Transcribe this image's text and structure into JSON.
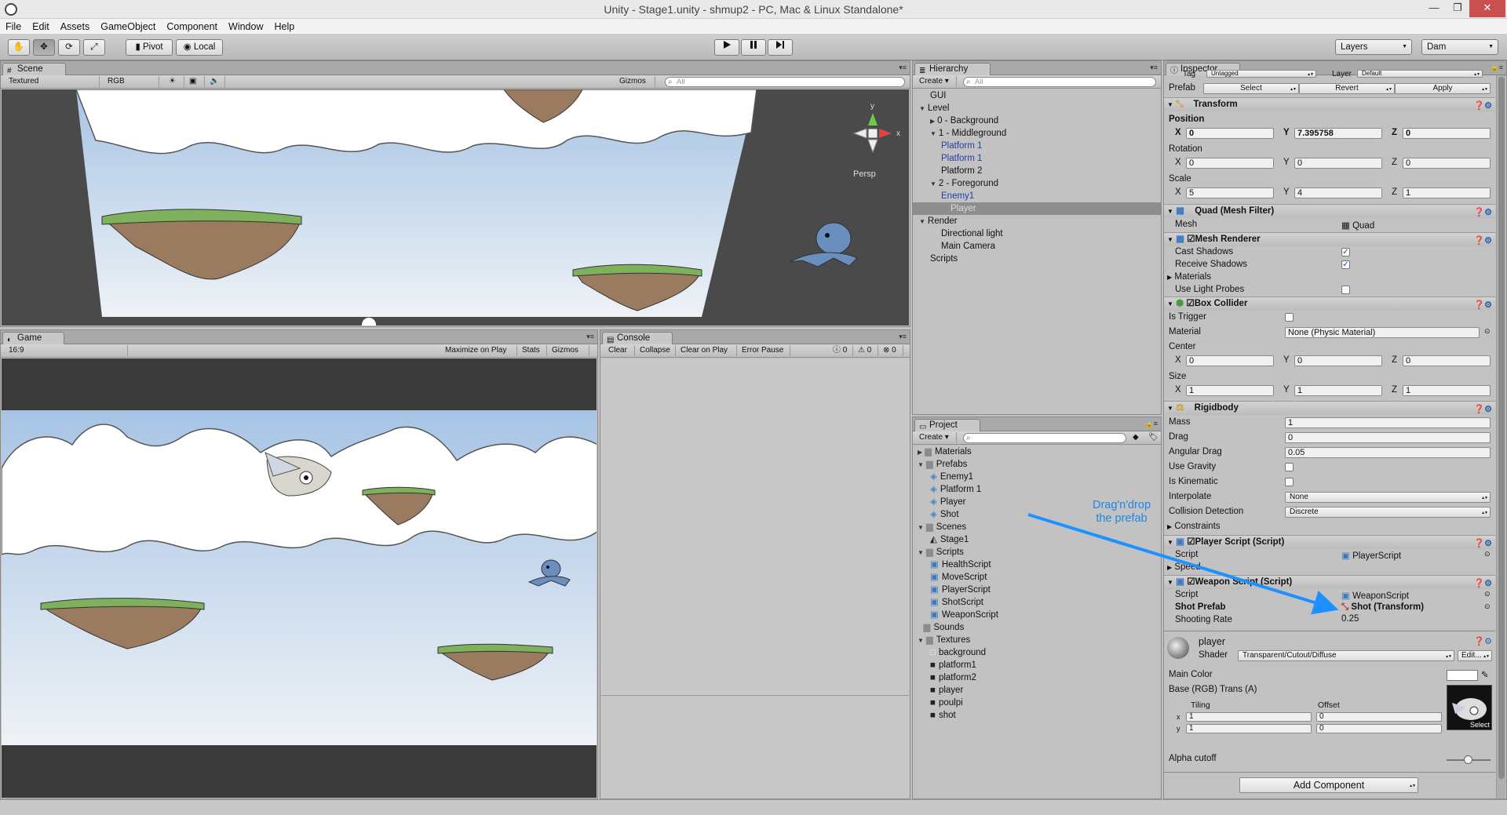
{
  "window": {
    "title": "Unity - Stage1.unity - shmup2 - PC, Mac & Linux Standalone*"
  },
  "menu": [
    "File",
    "Edit",
    "Assets",
    "GameObject",
    "Component",
    "Window",
    "Help"
  ],
  "toolbar": {
    "pivot": "Pivot",
    "local": "Local",
    "layers": "Layers",
    "layout": "Dam"
  },
  "scene": {
    "tab": "Scene",
    "shading": "Textured",
    "mode": "RGB",
    "gizmos": "Gizmos",
    "search_placeholder": "All",
    "persp": "Persp",
    "gizmo_x": "x",
    "gizmo_y": "y"
  },
  "game": {
    "tab": "Game",
    "aspect": "16:9",
    "maximize": "Maximize on Play",
    "stats": "Stats",
    "gizmos": "Gizmos"
  },
  "console": {
    "tab": "Console",
    "clear": "Clear",
    "collapse": "Collapse",
    "clear_on_play": "Clear on Play",
    "error_pause": "Error Pause",
    "count_info": "0",
    "count_warn": "0",
    "count_error": "0"
  },
  "hierarchy": {
    "tab": "Hierarchy",
    "create": "Create",
    "search_placeholder": "All",
    "items": [
      {
        "label": "GUI",
        "indent": 0,
        "arrow": "",
        "style": ""
      },
      {
        "label": "Level",
        "indent": 0,
        "arrow": "down",
        "style": ""
      },
      {
        "label": "0 - Background",
        "indent": 1,
        "arrow": "right",
        "style": ""
      },
      {
        "label": "1 - Middleground",
        "indent": 1,
        "arrow": "down",
        "style": ""
      },
      {
        "label": "Platform 1",
        "indent": 2,
        "arrow": "",
        "style": "blue"
      },
      {
        "label": "Platform 1",
        "indent": 2,
        "arrow": "",
        "style": "blue"
      },
      {
        "label": "Platform 2",
        "indent": 2,
        "arrow": "",
        "style": ""
      },
      {
        "label": "2 - Foregorund",
        "indent": 1,
        "arrow": "down",
        "style": ""
      },
      {
        "label": "Enemy1",
        "indent": 2,
        "arrow": "",
        "style": "blue"
      },
      {
        "label": "Player",
        "indent": 2,
        "arrow": "",
        "style": "sel"
      },
      {
        "label": "Render",
        "indent": 0,
        "arrow": "down",
        "style": ""
      },
      {
        "label": "Directional light",
        "indent": 1,
        "arrow": "",
        "style": ""
      },
      {
        "label": "Main Camera",
        "indent": 1,
        "arrow": "",
        "style": ""
      },
      {
        "label": "Scripts",
        "indent": 0,
        "arrow": "",
        "style": ""
      }
    ]
  },
  "project": {
    "tab": "Project",
    "create": "Create",
    "items": [
      {
        "label": "Materials",
        "indent": 0,
        "arrow": "right",
        "icon": "folder"
      },
      {
        "label": "Prefabs",
        "indent": 0,
        "arrow": "down",
        "icon": "folder"
      },
      {
        "label": "Enemy1",
        "indent": 1,
        "arrow": "",
        "icon": "prefab"
      },
      {
        "label": "Platform 1",
        "indent": 1,
        "arrow": "",
        "icon": "prefab"
      },
      {
        "label": "Player",
        "indent": 1,
        "arrow": "",
        "icon": "prefab"
      },
      {
        "label": "Shot",
        "indent": 1,
        "arrow": "",
        "icon": "prefab"
      },
      {
        "label": "Scenes",
        "indent": 0,
        "arrow": "down",
        "icon": "folder"
      },
      {
        "label": "Stage1",
        "indent": 1,
        "arrow": "",
        "icon": "unity"
      },
      {
        "label": "Scripts",
        "indent": 0,
        "arrow": "down",
        "icon": "folder"
      },
      {
        "label": "HealthScript",
        "indent": 1,
        "arrow": "",
        "icon": "script"
      },
      {
        "label": "MoveScript",
        "indent": 1,
        "arrow": "",
        "icon": "script"
      },
      {
        "label": "PlayerScript",
        "indent": 1,
        "arrow": "",
        "icon": "script"
      },
      {
        "label": "ShotScript",
        "indent": 1,
        "arrow": "",
        "icon": "script"
      },
      {
        "label": "WeaponScript",
        "indent": 1,
        "arrow": "",
        "icon": "script"
      },
      {
        "label": "Sounds",
        "indent": 0,
        "arrow": "",
        "icon": "folder"
      },
      {
        "label": "Textures",
        "indent": 0,
        "arrow": "down",
        "icon": "folder"
      },
      {
        "label": "background",
        "indent": 1,
        "arrow": "",
        "icon": "tex-light"
      },
      {
        "label": "platform1",
        "indent": 1,
        "arrow": "",
        "icon": "tex-dark"
      },
      {
        "label": "platform2",
        "indent": 1,
        "arrow": "",
        "icon": "tex-dark"
      },
      {
        "label": "player",
        "indent": 1,
        "arrow": "",
        "icon": "tex-dark"
      },
      {
        "label": "poulpi",
        "indent": 1,
        "arrow": "",
        "icon": "tex-dark"
      },
      {
        "label": "shot",
        "indent": 1,
        "arrow": "",
        "icon": "tex-dark"
      }
    ]
  },
  "inspector": {
    "tab": "Inspector",
    "tag_label": "Tag",
    "tag_value": "Untagged",
    "layer_label": "Layer",
    "layer_value": "Default",
    "prefab_label": "Prefab",
    "prefab_select": "Select",
    "prefab_revert": "Revert",
    "prefab_apply": "Apply",
    "transform": {
      "title": "Transform",
      "position": "Position",
      "rotation": "Rotation",
      "scale": "Scale",
      "pos": [
        "0",
        "7.395758",
        "0"
      ],
      "rot": [
        "0",
        "0",
        "0"
      ],
      "scl": [
        "5",
        "4",
        "1"
      ]
    },
    "axis": [
      "X",
      "Y",
      "Z"
    ],
    "mesh_filter": {
      "title": "Quad (Mesh Filter)",
      "mesh_label": "Mesh",
      "mesh_value": "Quad"
    },
    "mesh_renderer": {
      "title": "Mesh Renderer",
      "cast": "Cast Shadows",
      "receive": "Receive Shadows",
      "materials": "Materials",
      "light_probes": "Use Light Probes"
    },
    "box_collider": {
      "title": "Box Collider",
      "is_trigger": "Is Trigger",
      "material": "Material",
      "material_value": "None (Physic Material)",
      "center": "Center",
      "size": "Size",
      "center_v": [
        "0",
        "0",
        "0"
      ],
      "size_v": [
        "1",
        "1",
        "1"
      ]
    },
    "rigidbody": {
      "title": "Rigidbody",
      "mass": "Mass",
      "mass_v": "1",
      "drag": "Drag",
      "drag_v": "0",
      "angular": "Angular Drag",
      "angular_v": "0.05",
      "gravity": "Use Gravity",
      "kinematic": "Is Kinematic",
      "interpolate": "Interpolate",
      "interpolate_v": "None",
      "collision": "Collision Detection",
      "collision_v": "Discrete",
      "constraints": "Constraints"
    },
    "player_script": {
      "title": "Player Script (Script)",
      "script_label": "Script",
      "script_value": "PlayerScript",
      "speed": "Speed"
    },
    "weapon_script": {
      "title": "Weapon Script (Script)",
      "script_label": "Script",
      "script_value": "WeaponScript",
      "shot_label": "Shot Prefab",
      "shot_value": "Shot (Transform)",
      "rate_label": "Shooting Rate",
      "rate_value": "0.25"
    },
    "material": {
      "name": "player",
      "shader_label": "Shader",
      "shader_value": "Transparent/Cutout/Diffuse",
      "edit": "Edit...",
      "main_color": "Main Color",
      "base": "Base (RGB) Trans (A)",
      "tiling": "Tiling",
      "offset": "Offset",
      "tx": "1",
      "ty": "1",
      "ox": "0",
      "oy": "0",
      "select": "Select",
      "alpha": "Alpha cutoff",
      "alpha_value": 0.5
    },
    "add_component": "Add Component"
  },
  "annotation": {
    "line1": "Drag'n'drop",
    "line2": "the prefab"
  },
  "colors": {
    "arrow": "#1e90ff",
    "sky_top": "#a7c4e5",
    "sky_bottom": "#eef2f6"
  }
}
